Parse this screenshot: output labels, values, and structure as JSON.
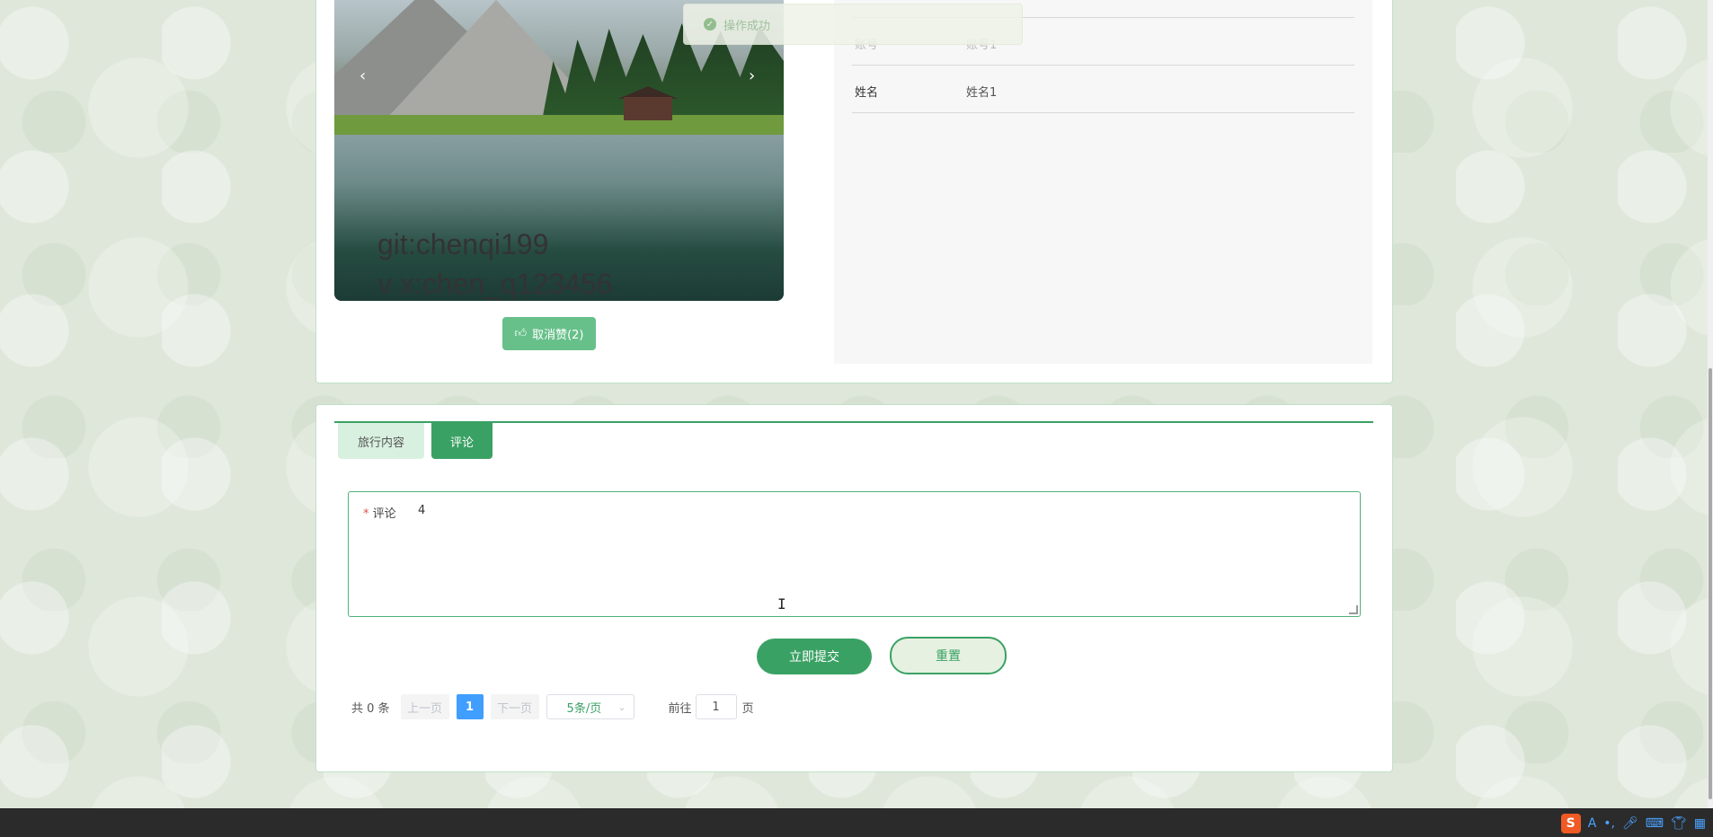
{
  "toast": {
    "message": "操作成功",
    "icon": "check-circle-icon"
  },
  "carousel": {
    "watermark_line1": "git:chenqi199",
    "watermark_line2": "v x:chen_q123456",
    "prev_icon": "‹",
    "next_icon": "›"
  },
  "like_button": {
    "label": "取消赞(2)",
    "icon": "thumbs-up-icon"
  },
  "info": [
    {
      "label": "",
      "value": ""
    },
    {
      "label": "账号",
      "value": "账号1"
    },
    {
      "label": "姓名",
      "value": "姓名1"
    }
  ],
  "tabs": [
    {
      "label": "旅行内容",
      "active": false
    },
    {
      "label": "评论",
      "active": true
    }
  ],
  "comment": {
    "label": "评论",
    "required_mark": "*",
    "value": "4"
  },
  "buttons": {
    "submit": "立即提交",
    "reset": "重置"
  },
  "pagination": {
    "total": "共 0 条",
    "prev": "上一页",
    "current": "1",
    "next": "下一页",
    "page_size": "5条/页",
    "goto_label": "前往",
    "goto_value": "1",
    "goto_suffix": "页"
  },
  "colors": {
    "primary": "#3aa164",
    "pager_active": "#409eff",
    "required": "#e05050"
  }
}
